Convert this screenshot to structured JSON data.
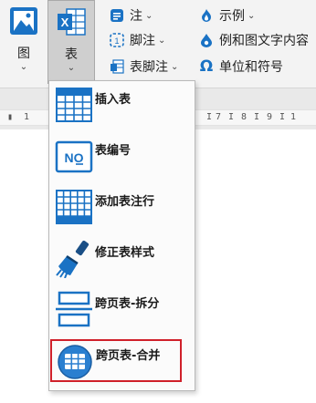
{
  "ribbon": {
    "picture_button": {
      "label": "图",
      "icon": "picture-icon"
    },
    "table_button": {
      "label": "表",
      "icon": "excel-table-icon"
    },
    "col2": [
      {
        "label": "注",
        "icon": "footnote-icon",
        "has_dropdown": true
      },
      {
        "label": "脚注",
        "icon": "footer-note-icon",
        "has_dropdown": true
      },
      {
        "label": "表脚注",
        "icon": "table-footnote-icon",
        "has_dropdown": true
      }
    ],
    "col3": [
      {
        "label": "示例",
        "icon": "flame-icon",
        "has_dropdown": true
      },
      {
        "label": "例和图文字内容",
        "icon": "drop-icon",
        "has_dropdown": false
      },
      {
        "label": "单位和符号",
        "icon": "omega-icon",
        "has_dropdown": false
      }
    ]
  },
  "ruler": {
    "marks": [
      "1",
      "1",
      "7",
      "8",
      "9",
      "1"
    ]
  },
  "menu": {
    "items": [
      {
        "label": "插入表",
        "icon": "insert-table-icon"
      },
      {
        "label": "表编号",
        "icon": "table-number-icon"
      },
      {
        "label": "添加表注行",
        "icon": "add-table-note-row-icon"
      },
      {
        "label": "修正表样式",
        "icon": "brush-style-icon"
      },
      {
        "label": "跨页表-拆分",
        "icon": "split-table-icon"
      },
      {
        "label": "跨页表-合并",
        "icon": "merge-table-icon"
      }
    ],
    "selected_index": 5
  },
  "colors": {
    "accent_blue": "#1a72c4",
    "selection_border": "#d0202a",
    "excel_green": "#1e7a45"
  }
}
